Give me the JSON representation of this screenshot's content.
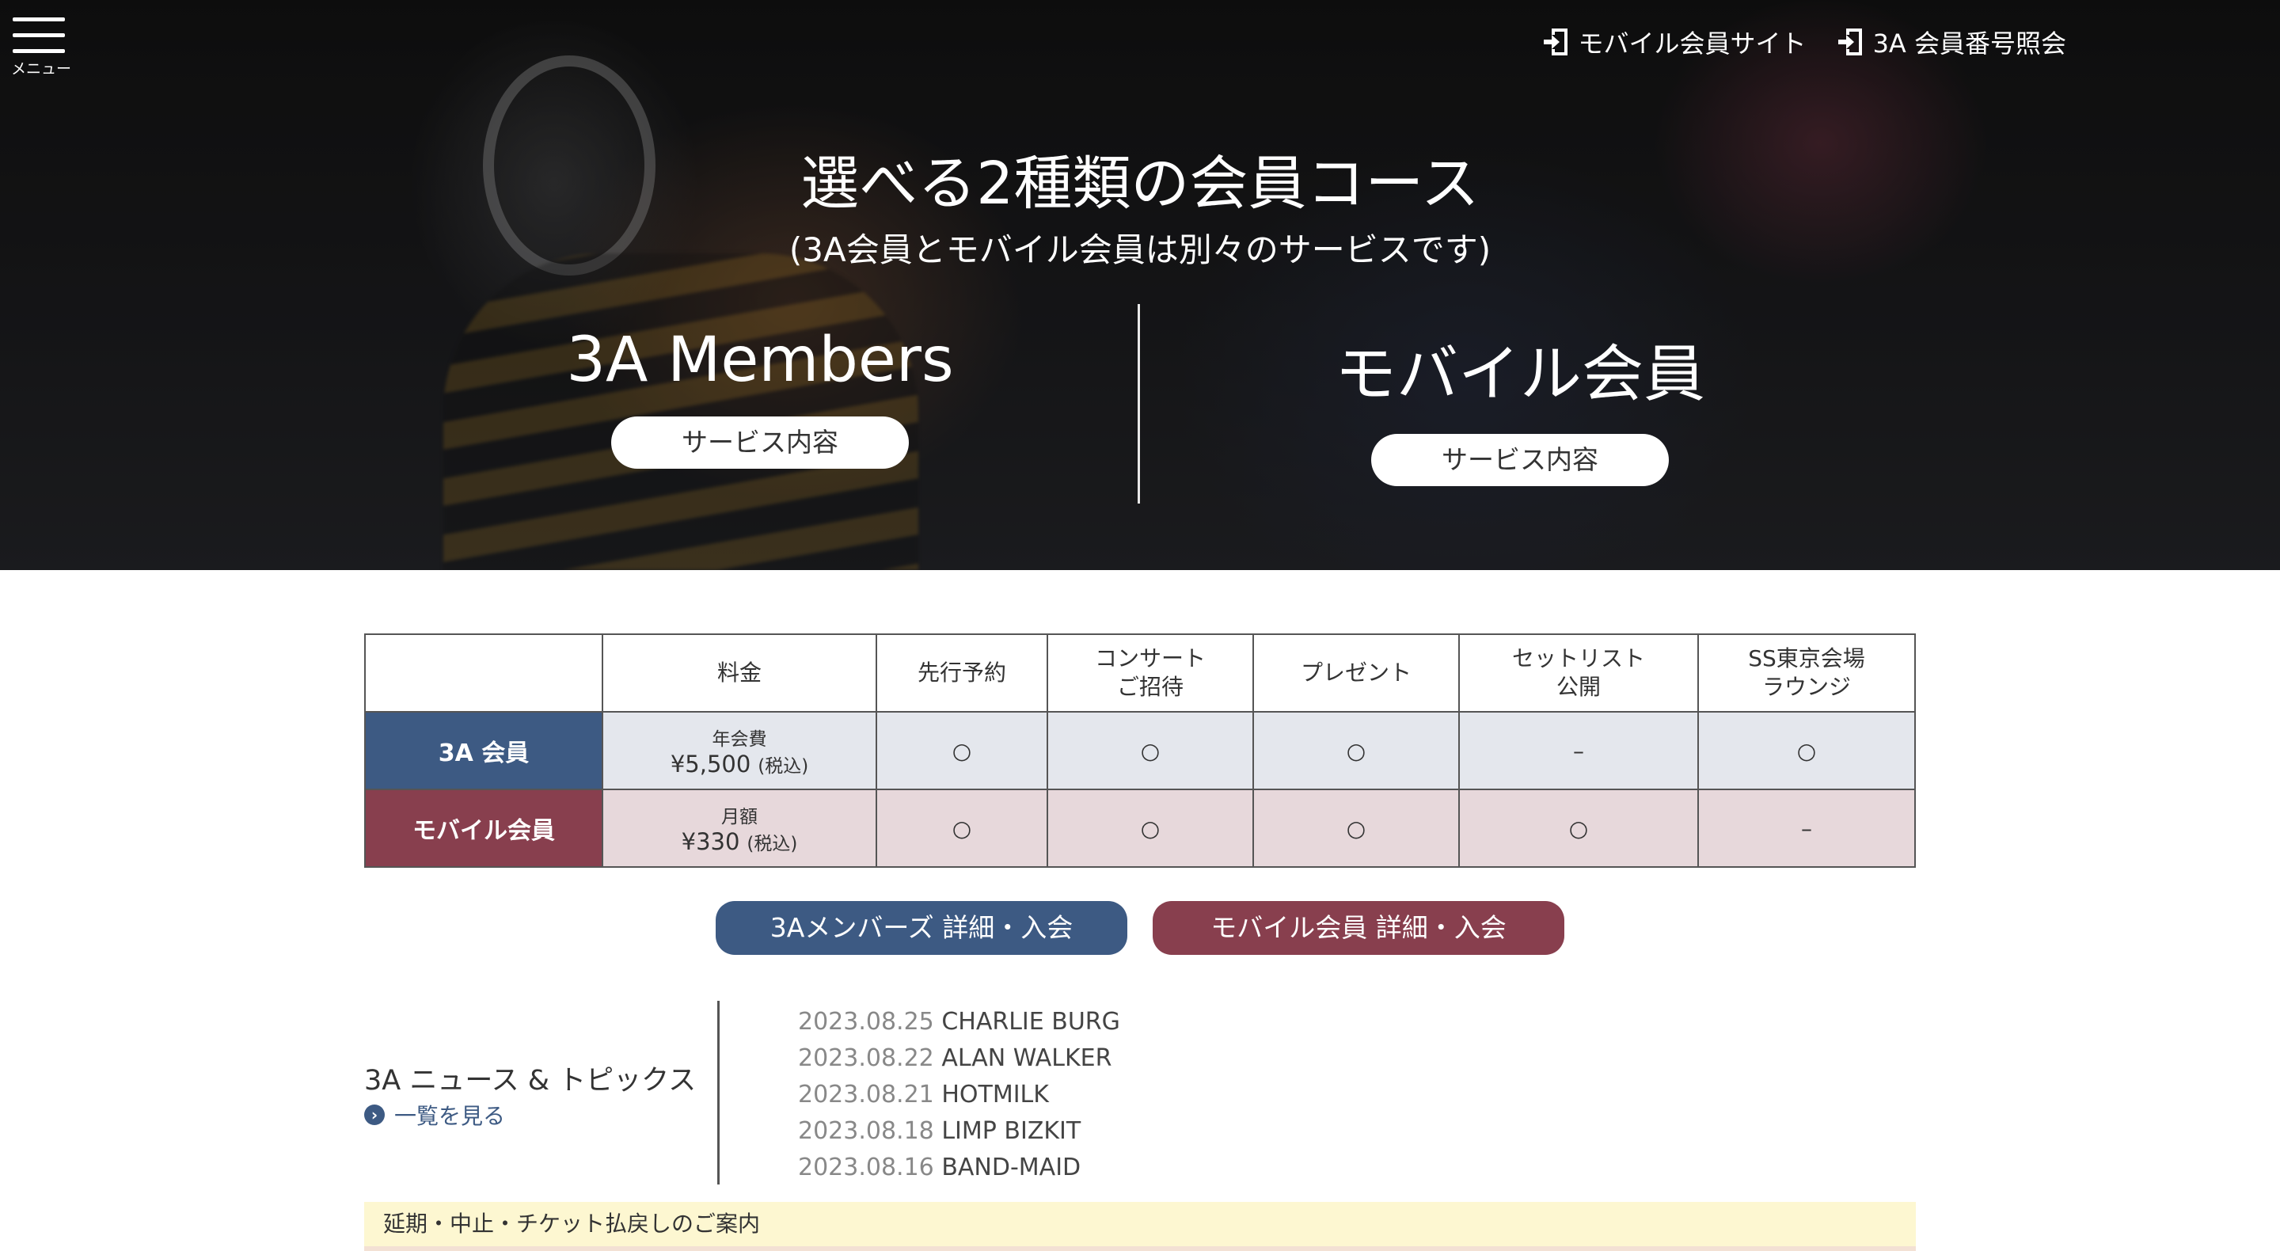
{
  "header": {
    "menu_label": "メニュー",
    "links": [
      {
        "label": "モバイル会員サイト",
        "icon": "sign-in-icon"
      },
      {
        "label": "3A 会員番号照会",
        "icon": "sign-in-icon"
      }
    ]
  },
  "hero": {
    "title": "選べる2種類の会員コース",
    "subtitle": "(3A会員とモバイル会員は別々のサービスです)",
    "courses": [
      {
        "name": "3A Members",
        "button": "サービス内容"
      },
      {
        "name": "モバイル会員",
        "button": "サービス内容"
      }
    ]
  },
  "comparison": {
    "headers": [
      "",
      "料金",
      "先行予約",
      "コンサート\nご招待",
      "プレゼント",
      "セットリスト\n公開",
      "SS東京会場\nラウンジ"
    ],
    "rows": [
      {
        "label": "3A 会員",
        "fee_period": "年会費",
        "fee_amount": "¥5,500",
        "fee_tax": "(税込)",
        "marks": [
          "○",
          "○",
          "○",
          "–",
          "○"
        ],
        "color": "#3d5a83"
      },
      {
        "label": "モバイル会員",
        "fee_period": "月額",
        "fee_amount": "¥330",
        "fee_tax": "(税込)",
        "marks": [
          "○",
          "○",
          "○",
          "○",
          "–"
        ],
        "color": "#883f4e"
      }
    ]
  },
  "cta": {
    "a": "3Aメンバーズ 詳細・入会",
    "b": "モバイル会員 詳細・入会"
  },
  "news": {
    "heading": "3A ニュース & トピックス",
    "more": "一覧を見る",
    "items": [
      {
        "date": "2023.08.25",
        "title": "CHARLIE BURG"
      },
      {
        "date": "2023.08.22",
        "title": "ALAN WALKER"
      },
      {
        "date": "2023.08.21",
        "title": "HOTMILK"
      },
      {
        "date": "2023.08.18",
        "title": "LIMP BIZKIT"
      },
      {
        "date": "2023.08.16",
        "title": "BAND-MAID"
      }
    ]
  },
  "notice": {
    "text": "延期・中止・チケット払戻しのご案内"
  }
}
